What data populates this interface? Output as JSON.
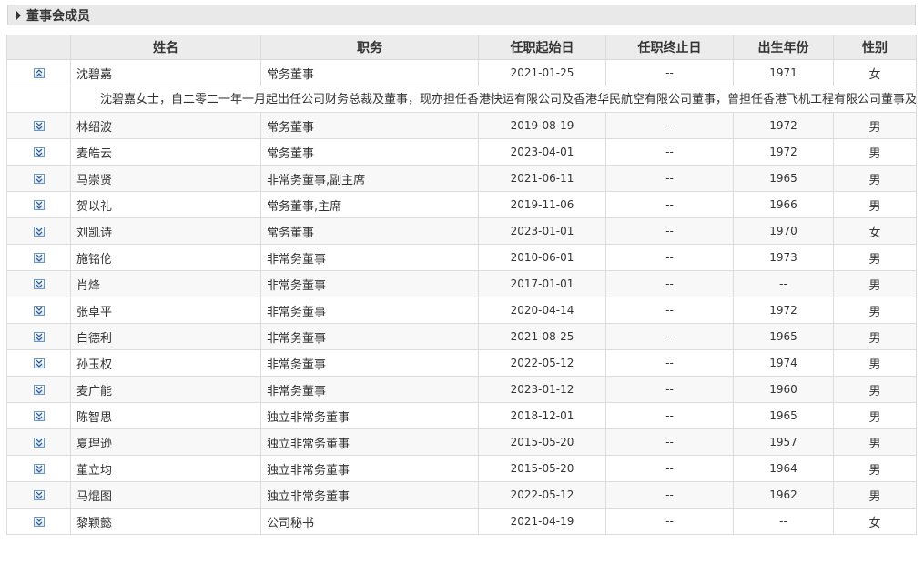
{
  "section": {
    "title": "董事会成员"
  },
  "columns": {
    "name": "姓名",
    "position": "职务",
    "start": "任职起始日",
    "end": "任职终止日",
    "birth": "出生年份",
    "gender": "性别"
  },
  "expanded_bio": "沈碧嘉女士，自二零二一年一月起出任公司财务总裁及董事，现亦担任香港快运有限公司及香港华民航空有限公司董事，曾担任香港飞机工程有限公司董事及集团财务董事，之前任职太古轮船有限公司财务董事。她於二零零八年加入太古集团，曾於该集团的香港中国内地及新加坡办事处工作。",
  "members": [
    {
      "name": "沈碧嘉",
      "position": "常务董事",
      "start": "2021-01-25",
      "end": "--",
      "birth": "1971",
      "gender": "女",
      "expanded": true
    },
    {
      "name": "林绍波",
      "position": "常务董事",
      "start": "2019-08-19",
      "end": "--",
      "birth": "1972",
      "gender": "男",
      "expanded": false
    },
    {
      "name": "麦皓云",
      "position": "常务董事",
      "start": "2023-04-01",
      "end": "--",
      "birth": "1972",
      "gender": "男",
      "expanded": false
    },
    {
      "name": "马崇贤",
      "position": "非常务董事,副主席",
      "start": "2021-06-11",
      "end": "--",
      "birth": "1965",
      "gender": "男",
      "expanded": false
    },
    {
      "name": "贺以礼",
      "position": "常务董事,主席",
      "start": "2019-11-06",
      "end": "--",
      "birth": "1966",
      "gender": "男",
      "expanded": false
    },
    {
      "name": "刘凯诗",
      "position": "常务董事",
      "start": "2023-01-01",
      "end": "--",
      "birth": "1970",
      "gender": "女",
      "expanded": false
    },
    {
      "name": "施铭伦",
      "position": "非常务董事",
      "start": "2010-06-01",
      "end": "--",
      "birth": "1973",
      "gender": "男",
      "expanded": false
    },
    {
      "name": "肖烽",
      "position": "非常务董事",
      "start": "2017-01-01",
      "end": "--",
      "birth": "--",
      "gender": "男",
      "expanded": false
    },
    {
      "name": "张卓平",
      "position": "非常务董事",
      "start": "2020-04-14",
      "end": "--",
      "birth": "1972",
      "gender": "男",
      "expanded": false
    },
    {
      "name": "白德利",
      "position": "非常务董事",
      "start": "2021-08-25",
      "end": "--",
      "birth": "1965",
      "gender": "男",
      "expanded": false
    },
    {
      "name": "孙玉权",
      "position": "非常务董事",
      "start": "2022-05-12",
      "end": "--",
      "birth": "1974",
      "gender": "男",
      "expanded": false
    },
    {
      "name": "麦广能",
      "position": "非常务董事",
      "start": "2023-01-12",
      "end": "--",
      "birth": "1960",
      "gender": "男",
      "expanded": false
    },
    {
      "name": "陈智思",
      "position": "独立非常务董事",
      "start": "2018-12-01",
      "end": "--",
      "birth": "1965",
      "gender": "男",
      "expanded": false
    },
    {
      "name": "夏理逊",
      "position": "独立非常务董事",
      "start": "2015-05-20",
      "end": "--",
      "birth": "1957",
      "gender": "男",
      "expanded": false
    },
    {
      "name": "董立均",
      "position": "独立非常务董事",
      "start": "2015-05-20",
      "end": "--",
      "birth": "1964",
      "gender": "男",
      "expanded": false
    },
    {
      "name": "马焜图",
      "position": "独立非常务董事",
      "start": "2022-05-12",
      "end": "--",
      "birth": "1962",
      "gender": "男",
      "expanded": false
    },
    {
      "name": "黎颖懿",
      "position": "公司秘书",
      "start": "2021-04-19",
      "end": "--",
      "birth": "--",
      "gender": "女",
      "expanded": false
    }
  ]
}
